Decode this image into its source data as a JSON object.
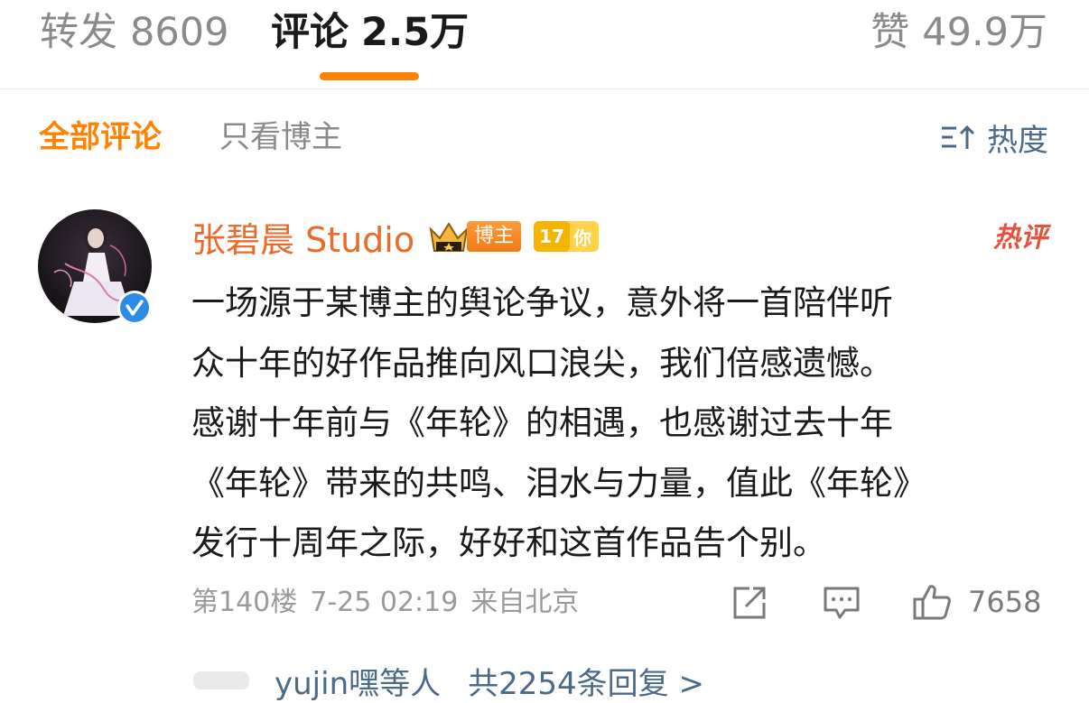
{
  "tabs": {
    "forward": {
      "label": "转发",
      "count": "8609"
    },
    "comments": {
      "label": "评论",
      "count": "2.5万"
    },
    "likes": {
      "label": "赞",
      "count": "49.9万"
    }
  },
  "filter": {
    "all": "全部评论",
    "blogger_only": "只看博主",
    "sort": "热度"
  },
  "comment": {
    "author": "张碧晨 Studio",
    "blogger_tag": "博主",
    "level": "17",
    "level_tag": "你",
    "hot_tag": "热评",
    "lines": [
      "一场源于某博主的舆论争议，意外将一首陪伴听",
      "众十年的好作品推向风口浪尖，我们倍感遗憾。",
      "感谢十年前与《年轮》的相遇，也感谢过去十年",
      "《年轮》带来的共鸣、泪水与力量，值此《年轮》",
      "发行十周年之际，好好和这首作品告个别。"
    ],
    "floor": "第140楼",
    "time": "7-25 02:19",
    "location": "来自北京",
    "likes": "7658",
    "reply_users": "yujin嘿等人",
    "reply_count": "共2254条回复 >"
  },
  "colors": {
    "accent": "#ff8200",
    "author": "#eb6a2a",
    "link": "#4a6a8a"
  }
}
